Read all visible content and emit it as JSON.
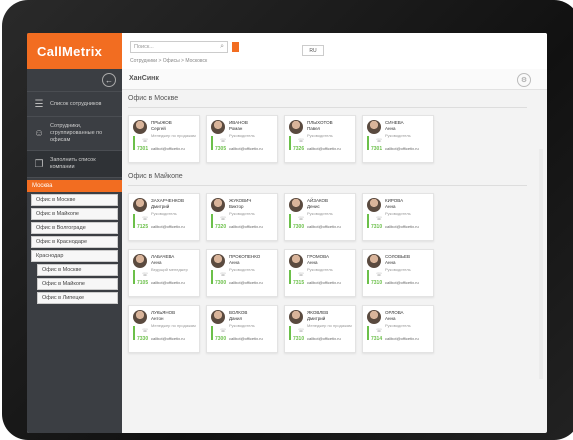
{
  "app": {
    "logo": "CallMetrix"
  },
  "sidebar": {
    "items": [
      {
        "label": "Список сотрудников",
        "icon": "user-list-icon"
      },
      {
        "label": "Сотрудники, сгруппированные по офисам",
        "icon": "users-icon"
      },
      {
        "label": "Заполнить список компании",
        "icon": "layers-icon"
      }
    ],
    "tree_head": "Москва",
    "tree": [
      {
        "label": "Офис в Москве",
        "level": 1
      },
      {
        "label": "Офис в Майкопе",
        "level": 1
      },
      {
        "label": "Офис в Волгограде",
        "level": 1
      },
      {
        "label": "Офис в Краснодаре",
        "level": 1
      },
      {
        "label": "Краснодар",
        "level": 1
      },
      {
        "label": "Офис в Москве",
        "level": 2
      },
      {
        "label": "Офис в Майкопе",
        "level": 2
      },
      {
        "label": "Офис в Липецке",
        "level": 2
      }
    ]
  },
  "topbar": {
    "search_placeholder": "Поиск...",
    "breadcrumb": "Сотрудники > Офисы > Московск",
    "lang": "RU"
  },
  "company": {
    "name": "ХанСинк"
  },
  "sections": {
    "moscow": "Офис в Москве",
    "maikop": "Офис в Майкопе"
  },
  "employees": [
    {
      "name": "ПРЫЖОВ\nСергей",
      "role": "Менеджер по продажам",
      "email": "callbot@officetix.ru",
      "ext": "7301"
    },
    {
      "name": "ИВАНОВ\nРоман",
      "role": "Руководитель",
      "email": "callbot@officetix.ru",
      "ext": "7305"
    },
    {
      "name": "ПЛЫХОТОВ\nПавел",
      "role": "Руководитель",
      "email": "callbot@officetix.ru",
      "ext": "7326"
    },
    {
      "name": "СИНЕВА\nАнна",
      "role": "Руководитель",
      "email": "callbot@officetix.ru",
      "ext": "7301"
    },
    {
      "name": "ЗАХАРЧЕНКОВ\nДмитрий",
      "role": "Руководитель",
      "email": "callbot@officetix.ru",
      "ext": "7125"
    },
    {
      "name": "ЖУКОВИЧ\nВиктор",
      "role": "Руководитель",
      "email": "callbot@officetix.ru",
      "ext": "7320"
    },
    {
      "name": "АЙЗАКОВ\nДенис",
      "role": "Руководитель",
      "email": "callbot@officetix.ru",
      "ext": "7300"
    },
    {
      "name": "КИРОВА\nАнна",
      "role": "Руководитель",
      "email": "callbot@officetix.ru",
      "ext": "7310"
    },
    {
      "name": "ЛАБАЧЕВА\nАнна",
      "role": "Ведущий менеджер",
      "email": "callbot@officetix.ru",
      "ext": "7105"
    },
    {
      "name": "ПРОКОПЕНКО\nАнна",
      "role": "Руководитель",
      "email": "callbot@officetix.ru",
      "ext": "7300"
    },
    {
      "name": "ГРОМОВА\nАнна",
      "role": "Руководитель",
      "email": "callbot@officetix.ru",
      "ext": "7315"
    },
    {
      "name": "СОЛОВЬЕВ\nАнна",
      "role": "Руководитель",
      "email": "callbot@officetix.ru",
      "ext": "7310"
    },
    {
      "name": "ЛУКЬЯНОВ\nАнтон",
      "role": "Менеджер по продажам",
      "email": "callbot@officetix.ru",
      "ext": "7330"
    },
    {
      "name": "ВОЛКОВ\nДанил",
      "role": "Руководитель",
      "email": "callbot@officetix.ru",
      "ext": "7300"
    },
    {
      "name": "ЯКОВЛЕВ\nДмитрий",
      "role": "Менеджер по продажам",
      "email": "callbot@officetix.ru",
      "ext": "7310"
    },
    {
      "name": "ОРЛОВА\nАнна",
      "role": "Руководитель",
      "email": "callbot@officetix.ru",
      "ext": "7314"
    }
  ],
  "colors": {
    "accent": "#f26d21",
    "sidebar": "#3b3e43",
    "online": "#6cc04a"
  }
}
